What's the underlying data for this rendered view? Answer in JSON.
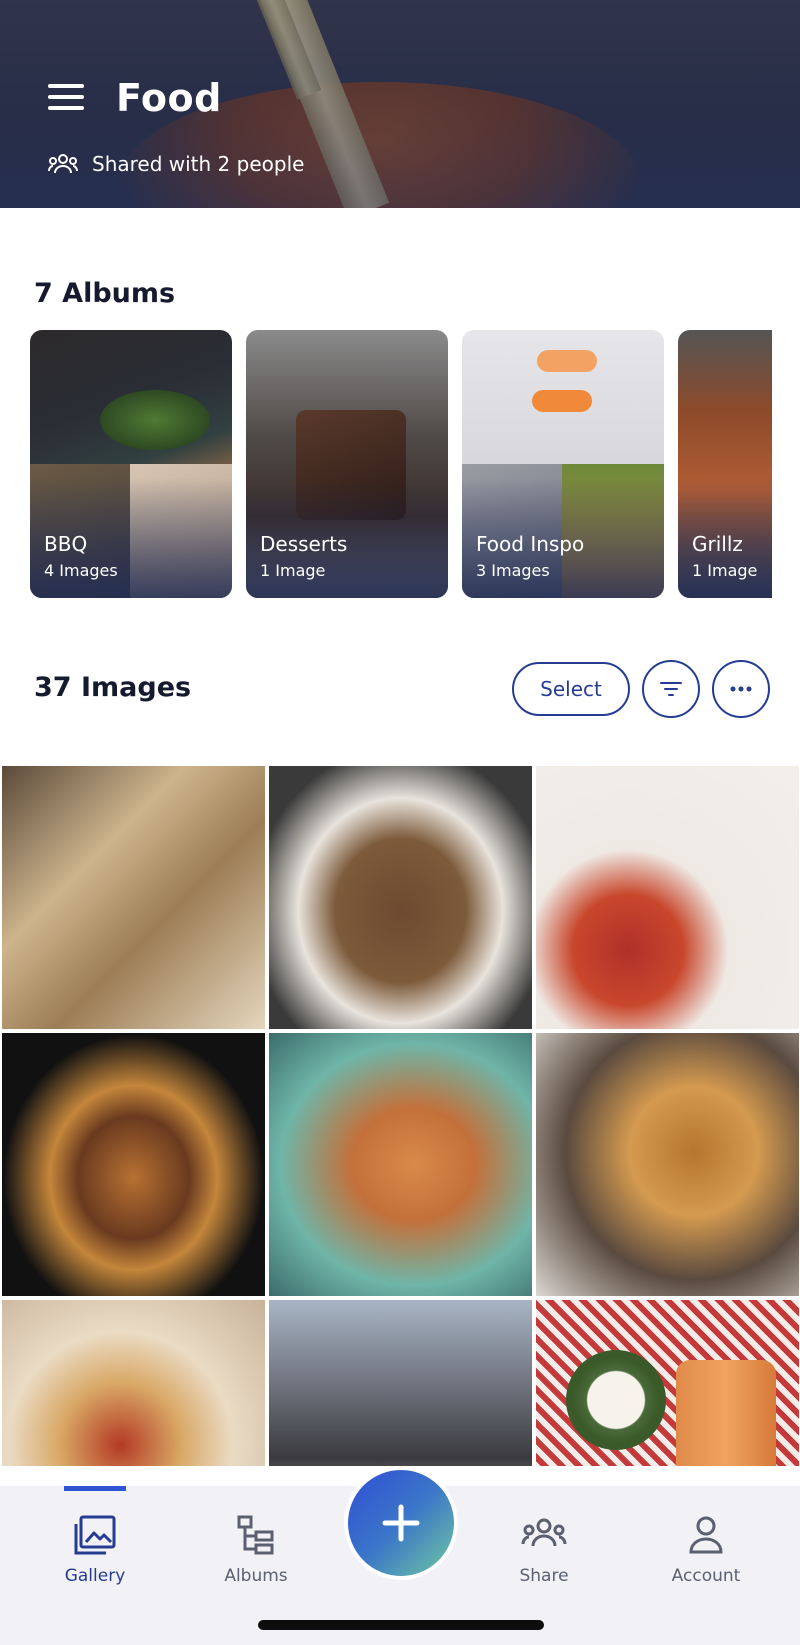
{
  "header": {
    "title": "Food",
    "shared_text": "Shared with 2 people"
  },
  "albums": {
    "section_title": "7 Albums",
    "items": [
      {
        "name": "BBQ",
        "count": "4 Images"
      },
      {
        "name": "Desserts",
        "count": "1 Image"
      },
      {
        "name": "Food Inspo",
        "count": "3 Images"
      },
      {
        "name": "Grillz",
        "count": "1 Image"
      }
    ]
  },
  "images": {
    "section_title": "37 Images",
    "select_label": "Select",
    "filter_icon": "filter-icon",
    "more_icon": "more-horizontal-icon"
  },
  "nav": {
    "items": [
      {
        "label": "Gallery",
        "icon": "gallery-icon",
        "active": true
      },
      {
        "label": "Albums",
        "icon": "albums-icon",
        "active": false
      },
      {
        "label": "Share",
        "icon": "share-icon",
        "active": false
      },
      {
        "label": "Account",
        "icon": "account-icon",
        "active": false
      }
    ],
    "fab_icon": "plus-icon"
  },
  "colors": {
    "accent": "#243d93",
    "active": "#2f55d4",
    "header_bg": "#2c3148",
    "nav_bg": "#f2f2f6"
  }
}
